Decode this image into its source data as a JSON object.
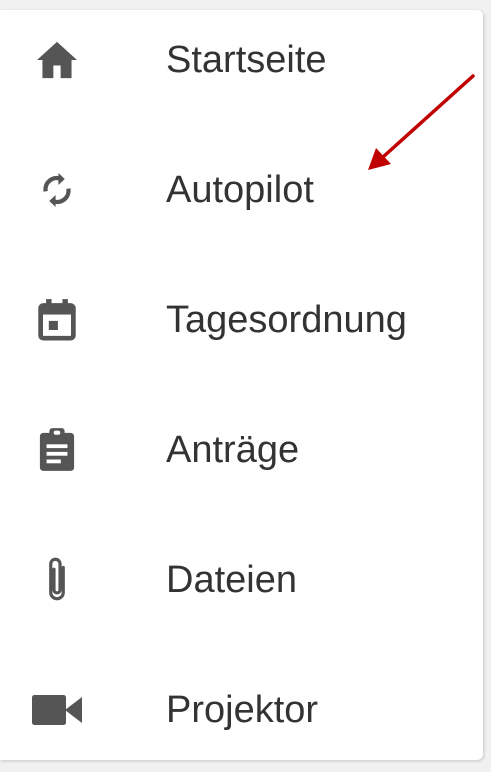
{
  "colors": {
    "icon": "#555555",
    "label": "#333333",
    "annotation_arrow": "#c00000"
  },
  "menu": {
    "items": [
      {
        "label": "Startseite",
        "icon": "home-icon"
      },
      {
        "label": "Autopilot",
        "icon": "sync-icon"
      },
      {
        "label": "Tagesordnung",
        "icon": "calendar-icon"
      },
      {
        "label": "Anträge",
        "icon": "clipboard-icon"
      },
      {
        "label": "Dateien",
        "icon": "paperclip-icon"
      },
      {
        "label": "Projektor",
        "icon": "videocam-icon"
      }
    ]
  }
}
